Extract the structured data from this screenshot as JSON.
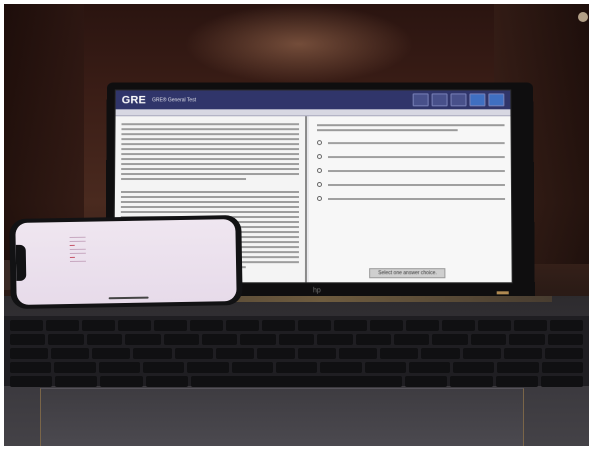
{
  "screen": {
    "brand": "GRE",
    "subtitle": "GRE® General Test",
    "select_prompt": "Select one answer choice."
  },
  "laptop": {
    "logo": "hp"
  },
  "icons": [
    "gre-logo-icon",
    "radio-icon",
    "hp-logo-icon"
  ]
}
